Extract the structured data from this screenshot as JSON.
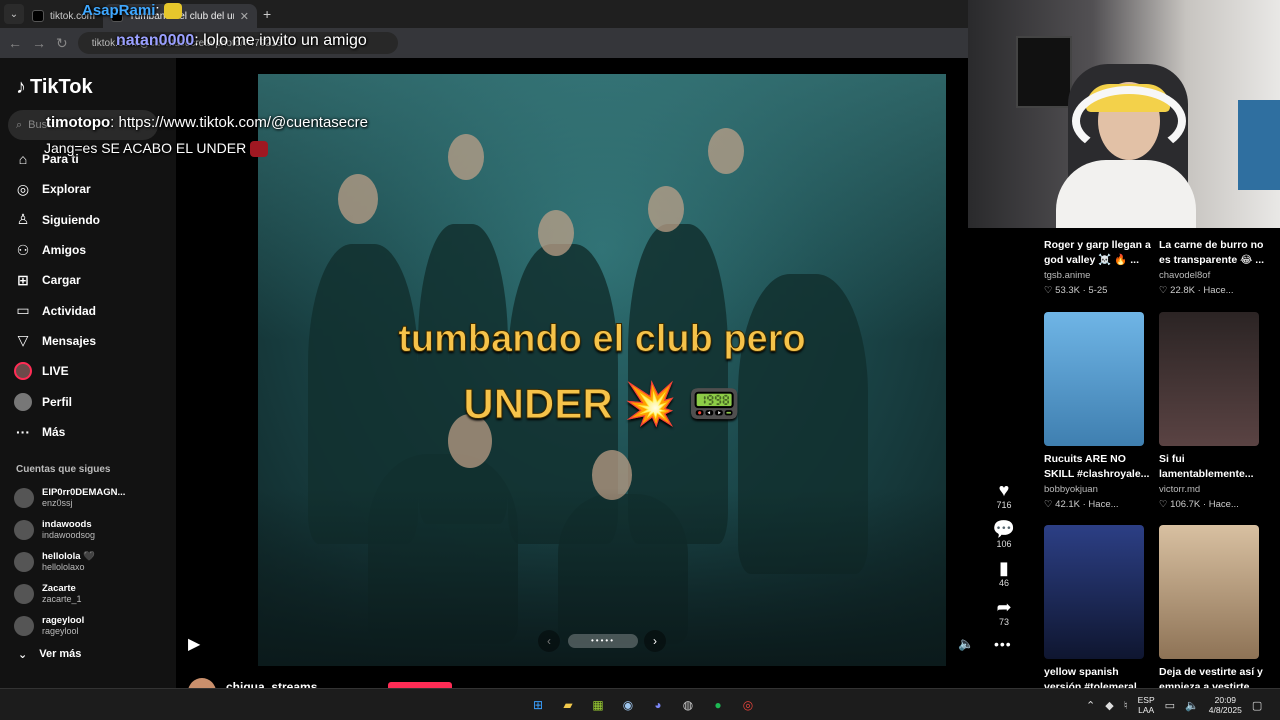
{
  "browser": {
    "tabs": [
      {
        "label": "tiktok.com",
        "active": false
      },
      {
        "label": "Tumbando el club del under #",
        "active": true
      }
    ],
    "new_tab": "+",
    "url": "tiktok.com/@cuentasecreta/photo/7479213"
  },
  "sidebar": {
    "logo": "TikTok",
    "search_placeholder": "Buscar",
    "nav": [
      {
        "label": "Para ti",
        "icon": "home-icon",
        "glyph": "⌂"
      },
      {
        "label": "Explorar",
        "icon": "compass-icon",
        "glyph": "◎"
      },
      {
        "label": "Siguiendo",
        "icon": "following-icon",
        "glyph": "♙"
      },
      {
        "label": "Amigos",
        "icon": "friends-icon",
        "glyph": "⚇"
      },
      {
        "label": "Cargar",
        "icon": "upload-icon",
        "glyph": "⊞"
      },
      {
        "label": "Actividad",
        "icon": "activity-icon",
        "glyph": "▭"
      },
      {
        "label": "Mensajes",
        "icon": "messages-icon",
        "glyph": "▽"
      },
      {
        "label": "LIVE",
        "icon": "live-avatar",
        "glyph": ""
      },
      {
        "label": "Perfil",
        "icon": "profile-avatar",
        "glyph": ""
      },
      {
        "label": "Más",
        "icon": "more-icon",
        "glyph": "···"
      }
    ],
    "following_header": "Cuentas que sigues",
    "following": [
      {
        "name": "ElP0rr0DEMAGN...",
        "user": "enz0ssj"
      },
      {
        "name": "indawoods",
        "user": "indawoodsog"
      },
      {
        "name": "hellolola 🖤",
        "user": "hellololaxo"
      },
      {
        "name": "Zacarte",
        "user": "zacarte_1"
      },
      {
        "name": "rageylool",
        "user": "rageylool"
      }
    ],
    "see_more": "Ver más",
    "see_more_icon": "⌄"
  },
  "video": {
    "caption_line1": "tumbando el club pero",
    "caption_line2": "UNDER 💥 📟",
    "carousel_dots": "•••••",
    "prev": "‹",
    "next": "›"
  },
  "actions": {
    "likes": "716",
    "comments": "106",
    "saves": "46",
    "shares": "73"
  },
  "player": {
    "play": "▶",
    "volume": "🔈",
    "more": "•••"
  },
  "author_bar": {
    "name": "chiqua_streams"
  },
  "recommendations": [
    {
      "title": "Roger y garp llegan a god valley ☠️ 🔥 ...",
      "author": "tgsb.anime",
      "meta": "♡ 53.3K · 5-25",
      "thumb": "#101010"
    },
    {
      "title": "La carne de burro no es transparente 😂 ...",
      "author": "chavodel8of",
      "meta": "♡ 22.8K · Hace...",
      "thumb": "#101010"
    },
    {
      "title": "Rucuits ARE NO SKILL #clashroyale...",
      "author": "bobbyokjuan",
      "meta": "♡ 42.1K · Hace...",
      "thumb": "#4f9fd4"
    },
    {
      "title": "Si fui lamentablemente...",
      "author": "victorr.md",
      "meta": "♡ 106.7K · Hace...",
      "thumb": "#3a2b2b"
    },
    {
      "title": "yellow spanish versión #tolemeral",
      "author": "",
      "meta": "",
      "thumb": "#1c2a5a"
    },
    {
      "title": "Deja de vestirte así y empieza a vestirte",
      "author": "",
      "meta": "",
      "thumb": "#b59a7c"
    }
  ],
  "chat": [
    {
      "user": "AsapRami",
      "text": ":"
    },
    {
      "user": "natan0000",
      "text": ": lolo me invito un amigo"
    },
    {
      "user": "timotopo",
      "text": ": https://www.tiktok.com/@cuentasecre"
    },
    {
      "user": "",
      "text": "Jang=es SE ACABO EL UNDER"
    }
  ],
  "taskbar": {
    "lang_top": "ESP",
    "lang_bottom": "LAA",
    "time": "20:09",
    "date": "4/8/2025"
  }
}
